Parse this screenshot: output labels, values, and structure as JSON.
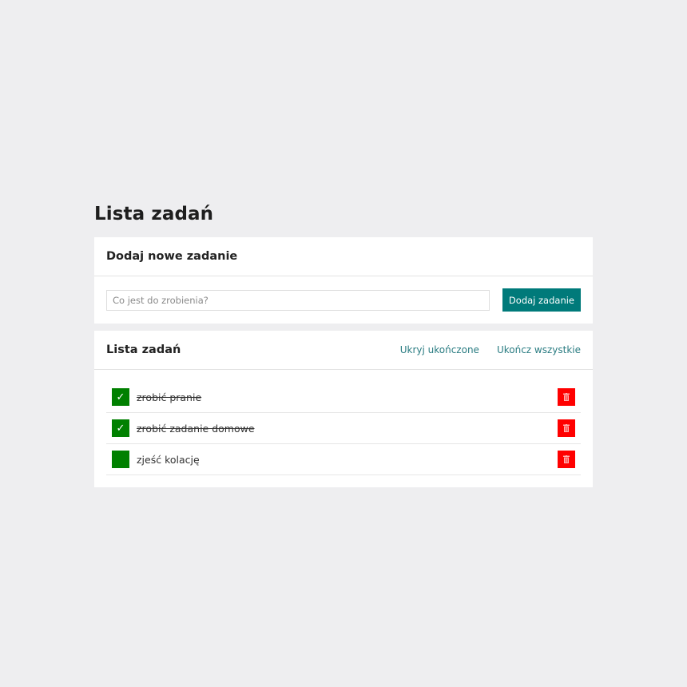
{
  "page": {
    "title": "Lista zadań"
  },
  "add_card": {
    "title": "Dodaj nowe zadanie",
    "input_placeholder": "Co jest do zrobienia?",
    "input_value": "",
    "button_label": "Dodaj zadanie"
  },
  "list_card": {
    "title": "Lista zadań",
    "hide_completed_label": "Ukryj ukończone",
    "complete_all_label": "Ukończ wszystkie",
    "tasks": [
      {
        "text": "zrobić pranie",
        "done": true,
        "check_glyph": "✓"
      },
      {
        "text": "zrobić zadanie domowe",
        "done": true,
        "check_glyph": "✓"
      },
      {
        "text": "zjeść kolację",
        "done": false,
        "check_glyph": ""
      }
    ]
  },
  "colors": {
    "background": "#eeeef0",
    "accent": "#007a7a",
    "link": "#2a7c82",
    "checkbox": "#008000",
    "delete": "#ff0000"
  },
  "icons": {
    "check": "check-icon",
    "delete": "trash-icon"
  }
}
